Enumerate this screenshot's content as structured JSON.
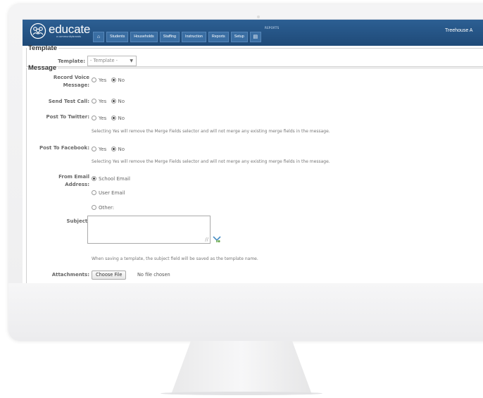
{
  "header": {
    "logo_text": "educate",
    "logo_sub": "a communitybrands",
    "reports_label": "REPORTS",
    "user": "Treehouse A",
    "nav": [
      "Students",
      "Households",
      "Staffing",
      "Instruction",
      "Reports",
      "Setup"
    ]
  },
  "template_section": {
    "title": "Template",
    "template_label": "Template:",
    "template_value": "- Template -"
  },
  "message_section": {
    "title": "Message",
    "record_voice_label": "Record Voice Message:",
    "send_test_call_label": "Send Test Call:",
    "post_twitter_label": "Post To Twitter:",
    "post_facebook_label": "Post To Facebook:",
    "yes": "Yes",
    "no": "No",
    "merge_hint": "Selecting Yes will remove the Merge Fields selector and will not merge any existing merge fields in the message.",
    "from_email_label": "From Email Address:",
    "school_email": "School Email",
    "user_email": "User Email",
    "other": "Other:",
    "subject_label": "Subject:",
    "subject_value": "",
    "subject_hint": "When saving a template, the subject field will be saved as the template name.",
    "attachments_label": "Attachments:",
    "choose_file": "Choose File",
    "no_file": "No file chosen"
  },
  "colors": {
    "header_top": "#2c5f93",
    "header_bottom": "#1f4a78",
    "nav_item": "#3a6ea3"
  }
}
